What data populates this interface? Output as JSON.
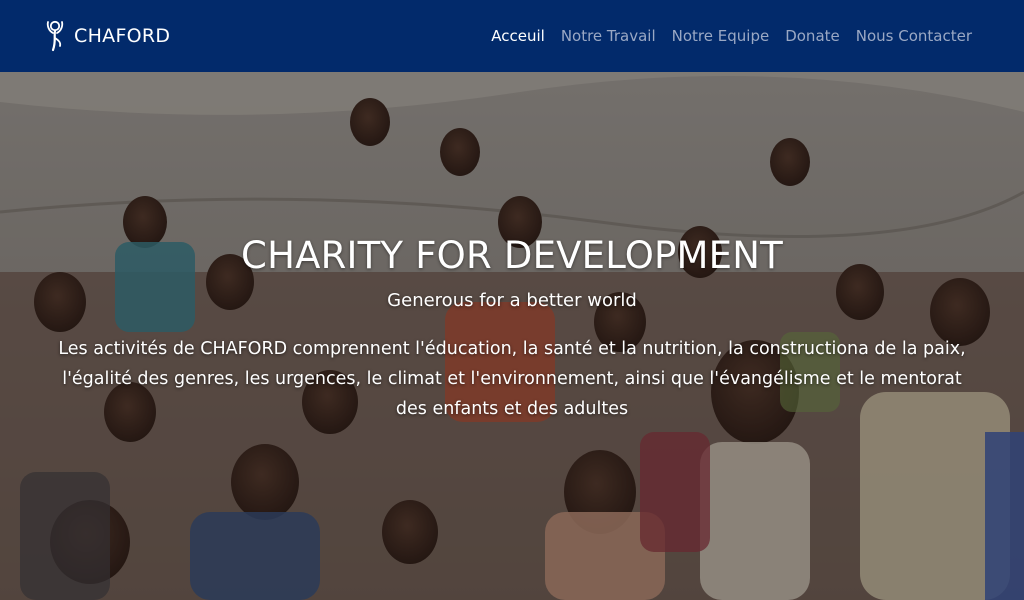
{
  "navbar": {
    "brand": "CHAFORD",
    "links": [
      {
        "label": "Acceuil",
        "active": true
      },
      {
        "label": "Notre Travail",
        "active": false
      },
      {
        "label": "Notre Equipe",
        "active": false
      },
      {
        "label": "Donate",
        "active": false
      },
      {
        "label": "Nous Contacter",
        "active": false
      }
    ]
  },
  "hero": {
    "title": "CHARITY FOR DEVELOPMENT",
    "subtitle": "Generous for a better world",
    "description": "Les activités de CHAFORD comprennent l'éducation, la santé et la nutrition, la constructiona de la paix, l'égalité des genres, les urgences, le climat et l'environnement, ainsi que l'évangélisme et le mentorat des enfants et des adultes"
  },
  "colors": {
    "navbar_bg": "#022a6b",
    "nav_active": "#ffffff",
    "nav_inactive": "#9aa8c4"
  },
  "icons": {
    "brand_logo": "dove-figure-logo-icon"
  }
}
